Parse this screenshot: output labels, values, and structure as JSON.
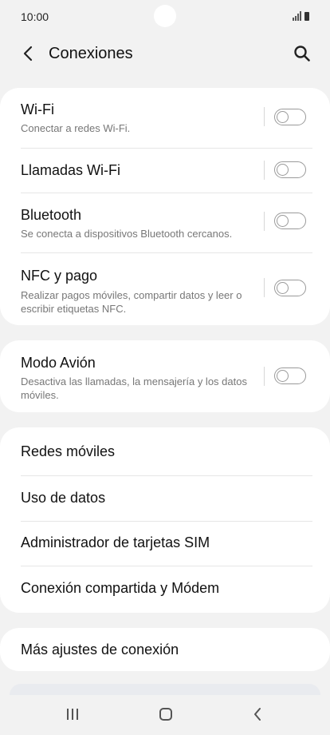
{
  "status": {
    "time": "10:00"
  },
  "header": {
    "title": "Conexiones",
    "back_icon": "chevron-left-icon",
    "search_icon": "search-icon"
  },
  "group1": [
    {
      "title": "Wi-Fi",
      "subtitle": "Conectar a redes Wi-Fi.",
      "toggle_on": false
    },
    {
      "title": "Llamadas Wi-Fi",
      "subtitle": "",
      "toggle_on": false
    },
    {
      "title": "Bluetooth",
      "subtitle": "Se conecta a dispositivos Bluetooth cercanos.",
      "toggle_on": false
    },
    {
      "title": "NFC y pago",
      "subtitle": "Realizar pagos móviles, compartir datos y leer o escribir etiquetas NFC.",
      "toggle_on": false
    }
  ],
  "group2": [
    {
      "title": "Modo Avión",
      "subtitle": "Desactiva las llamadas, la mensajería y los datos móviles.",
      "toggle_on": false
    }
  ],
  "group3": [
    {
      "title": "Redes móviles"
    },
    {
      "title": "Uso de datos"
    },
    {
      "title": "Administrador de tarjetas SIM"
    },
    {
      "title": "Conexión compartida y Módem"
    }
  ],
  "group4": [
    {
      "title": "Más ajustes de conexión"
    }
  ],
  "colors": {
    "background": "#f2f2f2",
    "card": "#ffffff",
    "toggle_off": "#9a9a9a"
  }
}
